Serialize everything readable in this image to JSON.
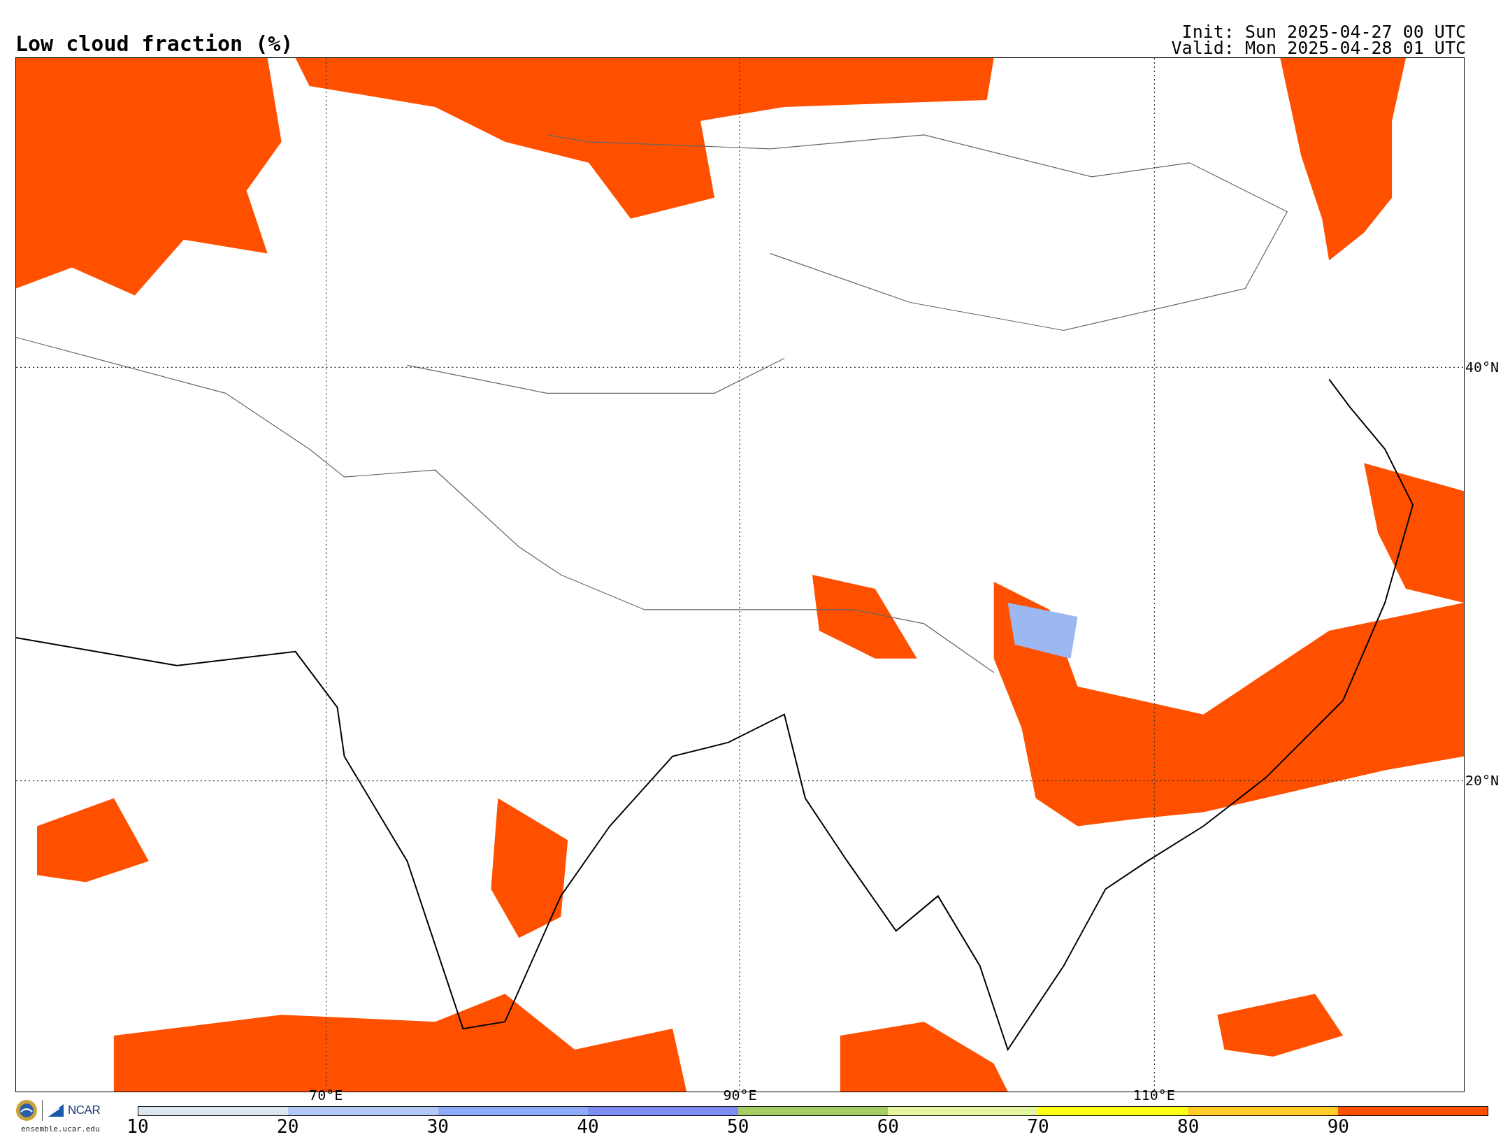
{
  "header": {
    "title": "Low cloud fraction (%)",
    "init": "Init: Sun 2025-04-27 00 UTC",
    "valid": "Valid: Mon 2025-04-28 01 UTC"
  },
  "map": {
    "lat_labels": [
      "40°N",
      "20°N"
    ],
    "lon_labels": [
      "70°E",
      "90°E",
      "110°E"
    ]
  },
  "logo": {
    "brand": "NCAR",
    "url": "ensemble.ucar.edu"
  },
  "colorbar": {
    "segments": [
      {
        "color": "#dce6f0"
      },
      {
        "color": "#b4c8f5"
      },
      {
        "color": "#8caaf5"
      },
      {
        "color": "#7d8cf0"
      },
      {
        "color": "#a5cd64"
      },
      {
        "color": "#e6f5a0"
      },
      {
        "color": "#ffff14"
      },
      {
        "color": "#ffcd28"
      },
      {
        "color": "#ff5000"
      }
    ],
    "ticks": [
      "10",
      "20",
      "30",
      "40",
      "50",
      "60",
      "70",
      "80",
      "90"
    ]
  }
}
